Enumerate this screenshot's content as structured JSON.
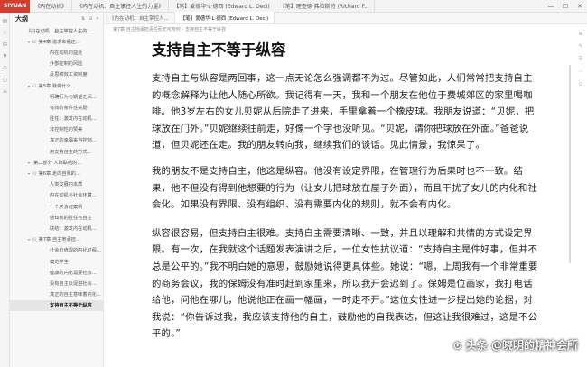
{
  "titlebar": {
    "logo": "SIYUAN",
    "tabs": [
      "《内在动机》",
      "《内在动机：自主掌控人生的力量》",
      "【笔】爱德华·L·德西 (Edward L. Deci)",
      "【笔】理查德·弗拉斯特 (Richard F..."
    ],
    "min": "—",
    "max": "☐",
    "close": "✕"
  },
  "leftstrip": {
    "icons": [
      "▤",
      "☆",
      "⊞",
      "⚑",
      "⊙",
      "▢",
      "≡"
    ]
  },
  "outline": {
    "title": "大纲",
    "tools": "⇅ ⊟ ✕",
    "items": [
      {
        "label": "《内在动机：自主掌控人生的...",
        "level": "l1",
        "arrow": "",
        "h": "",
        "active": false
      },
      {
        "label": "第4章 追求幸福还...",
        "level": "l2",
        "arrow": "▾",
        "h": "H2",
        "active": false
      },
      {
        "label": "内在动机的益处",
        "level": "l3",
        "arrow": "",
        "h": "",
        "active": false
      },
      {
        "label": "外部控制的风险",
        "level": "l3",
        "arrow": "",
        "h": "",
        "active": false
      },
      {
        "label": "反思绩效工资制度",
        "level": "l3",
        "arrow": "",
        "h": "",
        "active": false
      },
      {
        "label": "第5章 我做什么...",
        "level": "l2",
        "arrow": "▾",
        "h": "H2",
        "active": false
      },
      {
        "label": "明确行为与期望之间...",
        "level": "l3",
        "arrow": "",
        "h": "",
        "active": false
      },
      {
        "label": "有效的条件性奖励",
        "level": "l3",
        "arrow": "",
        "h": "",
        "active": false
      },
      {
        "label": "胜任：激发内在动机...",
        "level": "l3",
        "arrow": "",
        "h": "",
        "active": false
      },
      {
        "label": "非控制性的赞美",
        "level": "l3",
        "arrow": "",
        "h": "",
        "active": false
      },
      {
        "label": "真正的幸福来自控制...",
        "level": "l3",
        "arrow": "",
        "h": "",
        "active": false
      },
      {
        "label": "用支持自主的方式...",
        "level": "l3",
        "arrow": "",
        "h": "",
        "active": false
      },
      {
        "label": "第二部分 人际联结的...",
        "level": "l2",
        "arrow": "▾",
        "h": "",
        "active": false
      },
      {
        "label": "第6章 走向自我的...",
        "level": "l2",
        "arrow": "▾",
        "h": "H2",
        "active": false
      },
      {
        "label": "人类发展的本质",
        "level": "l3",
        "arrow": "",
        "h": "",
        "active": false
      },
      {
        "label": "内在动机与社会环境...",
        "level": "l3",
        "arrow": "",
        "h": "",
        "active": false
      },
      {
        "label": "一个厌食症案例",
        "level": "l3",
        "arrow": "",
        "h": "",
        "active": false
      },
      {
        "label": "感知到的胜任与自主",
        "level": "l3",
        "arrow": "",
        "h": "",
        "active": false
      },
      {
        "label": "联结：激发内在动机...",
        "level": "l3",
        "arrow": "",
        "h": "",
        "active": false
      },
      {
        "label": "第7章 自主地承担...",
        "level": "l2",
        "arrow": "▾",
        "h": "H2",
        "active": false
      },
      {
        "label": "社会价值观的内化过程...",
        "level": "l3",
        "arrow": "",
        "h": "",
        "active": false
      },
      {
        "label": "模范学生",
        "level": "l3",
        "arrow": "",
        "h": "",
        "active": false
      },
      {
        "label": "健康的内化需要社会...",
        "level": "l3",
        "arrow": "",
        "h": "",
        "active": false
      },
      {
        "label": "没有自主以促进社会...",
        "level": "l3",
        "arrow": "",
        "h": "",
        "active": false
      },
      {
        "label": "真正的自主意味着内化...",
        "level": "l3",
        "arrow": "",
        "h": "",
        "active": false
      },
      {
        "label": "支持自主不等于纵容",
        "level": "l3",
        "arrow": "",
        "h": "",
        "active": true
      }
    ]
  },
  "editor": {
    "tabs": [
      {
        "label": "《内在动机：自主掌控人...",
        "active": false
      },
      {
        "label": "【笔】爱德华·L·德西 (Edward L. Deci)",
        "active": true
      }
    ],
    "breadcrumb": "第7章 自主地承担责任而无可奈何   ›   支持自主不等于纵容",
    "right_icons": [
      "⊞",
      "✎",
      "☰",
      "⋯",
      "⊙"
    ],
    "title": "支持自主不等于纵容",
    "paragraphs": [
      "支持自主与纵容是两回事，这一点无论怎么强调都不为过。尽管如此，人们常常把支持自主的概念解释为让他人随心所欲。我记得有一天，我和一个朋友在他位于费城郊区的家里喝咖啡。他3岁左右的女儿贝妮从后院走了进来，手里拿着一个橡皮球。我朋友说道：“贝妮，把球放在门外。”贝妮继续往前走，好像一个字也没听见。“贝妮，请你把球放在外面。”爸爸说道，但贝妮还在走。我的朋友转向我，继续我们的谈话。见此情景，我惊呆了。",
      "我的朋友不是支持自主，他这是纵容。他没有设定界限，在管理行为后果时也不一致。结果，他不但没有得到他想要的行为（让女儿把球放在屋子外面），而且干扰了女儿的内化和社会化。如果没有界限、没有组织、没有需要内化的规则，就不会有内化。",
      "纵容很容易，但支持自主很难。支持自主需要清晰、一致，并且以理解和共情的方式设定界限。有一次，在我就这个话题发表演讲之后，一位女性抗议道：“支持自主是件好事，但并不总是公平的。”我不明白她的意思，鼓励她说得更具体些。她说：“嗯，上周我有一个非常重要的商务会议，我的保姆没有准时赶到家里来，所以我开会迟到了。保姆是位画家，我打电话给他，问他在哪儿，他说他正在画一幅画，一时走不开。”这位女性进一步提出她的论据，对我说：“你告诉过我，我应该支持他的自主，鼓励他的自我表达，但这让我很难过，这是不公平的。”"
    ]
  },
  "watermark": "⊙ 头条 @晓明的精神会所"
}
